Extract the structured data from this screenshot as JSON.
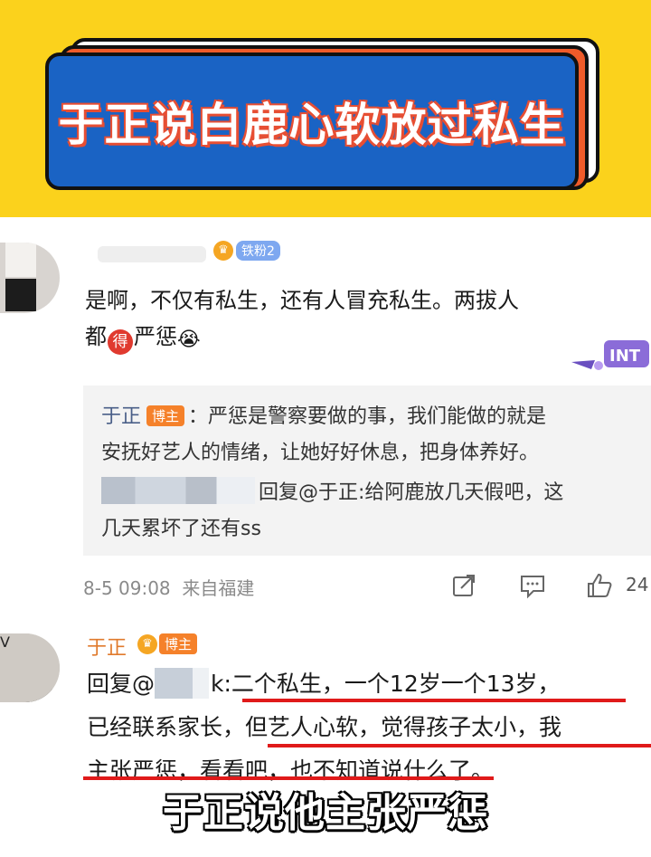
{
  "banner": {
    "title": "于正说白鹿心软放过私生",
    "colors": {
      "background": "#fbd21c",
      "card": "#1a63c4",
      "accent": "#ef5b2a"
    }
  },
  "comment1": {
    "fan_badge": "铁粉2",
    "text_line1": "是啊，不仅有私生，还有人冒充私生。两拔人",
    "text_line2_prefix": "都",
    "de_badge": "得",
    "text_line2_suffix": "严惩",
    "emoji": "😭",
    "replies": {
      "author": "于正",
      "author_badge": "博主",
      "line1": "：严惩是警察要做的事，我们能做的就是",
      "line2": "安抚好艺人的情绪，让她好好休息，把身体养好。",
      "line3": "回复@于正:给阿鹿放几天假吧，这",
      "line4": "几天累坏了还有ss"
    },
    "meta": {
      "timestamp": "8-5 09:08",
      "source": "来自福建",
      "likes": "24"
    }
  },
  "comment2": {
    "author": "于正",
    "author_badge": "博主",
    "line1_prefix": "回复@",
    "line1_suffix": "k:二个私生，一个12岁一个13岁，",
    "line2": "已经联系家长，但艺人心软，觉得孩子太小，我",
    "line3": "主张严惩，看看吧，也不知道说什么了。"
  },
  "caption": "于正说他主张严惩",
  "icons": [
    "crown-icon",
    "share-icon",
    "comment-icon",
    "like-icon",
    "verified-icon"
  ]
}
